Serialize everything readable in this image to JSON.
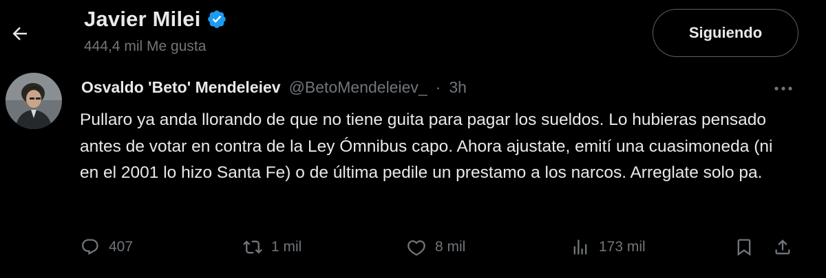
{
  "header": {
    "name": "Javier Milei",
    "likes_count": "444,4 mil Me gusta",
    "follow_label": "Siguiendo",
    "back_icon": "arrow-left-icon",
    "verified_icon": "verified-badge-icon"
  },
  "tweet": {
    "author_name": "Osvaldo 'Beto' Mendeleiev",
    "author_handle": "@BetoMendeleiev_",
    "separator": "·",
    "time": "3h",
    "text": "Pullaro ya anda llorando de que no tiene guita para pagar los sueldos. Lo hubieras pensado antes de votar en contra de la Ley Ómnibus capo. Ahora ajustate, emití una cuasimoneda (ni en el 2001 lo hizo Santa Fe) o de última pedile un prestamo a los narcos. Arreglate solo pa.",
    "actions": {
      "replies": "407",
      "retweets": "1 mil",
      "likes": "8 mil",
      "views": "173 mil"
    }
  },
  "colors": {
    "background": "#000000",
    "text_primary": "#e7e9ea",
    "text_secondary": "#71767b",
    "verified": "#1d9bf0",
    "border": "#536471"
  }
}
